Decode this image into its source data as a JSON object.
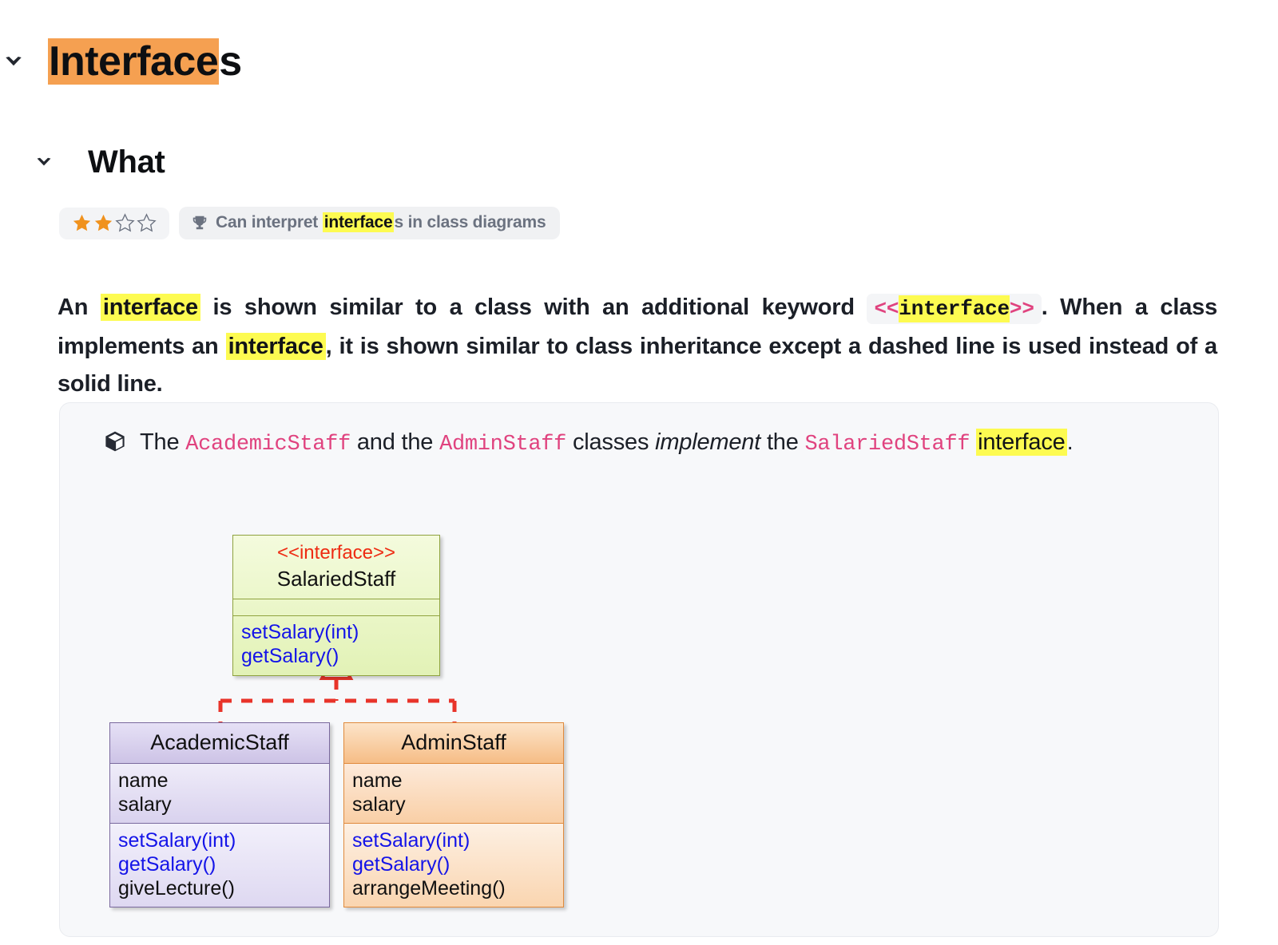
{
  "headings": {
    "h1": {
      "highlighted": "Interface",
      "rest": "s"
    },
    "h2": "What"
  },
  "badge": {
    "stars_filled": 2,
    "stars_total": 4,
    "trophy_icon": "trophy-icon",
    "outcome_pre": "Can interpret ",
    "outcome_mark": "interface",
    "outcome_post": "s in class diagrams"
  },
  "paragraph": {
    "p1": "An ",
    "m1": "interface",
    "p2": " is shown similar to a class with an additional keyword ",
    "code_open": "<<",
    "code_mark": "interface",
    "code_close": ">>",
    "p3": ". When a class implements an ",
    "m2": "interface",
    "p4": ", it is shown similar to class inheritance except a dashed line is used instead of a solid line."
  },
  "callout": {
    "icon": "cube-icon",
    "t1": "The ",
    "c1": "AcademicStaff",
    "t2": " and the ",
    "c2": "AdminStaff",
    "t3": " classes ",
    "em": "implement",
    "t4": " the ",
    "c3": "SalariedStaff",
    "t5": " ",
    "m1": "interface",
    "t6": "."
  },
  "diagram": {
    "interface_box": {
      "stereotype": "<<interface>>",
      "name": "SalariedStaff",
      "attributes": [],
      "methods": [
        "setSalary(int)",
        "getSalary()"
      ]
    },
    "academic_box": {
      "name": "AcademicStaff",
      "attributes": [
        "name",
        "salary"
      ],
      "methods": [
        {
          "text": "setSalary(int)",
          "color": "#1414e8"
        },
        {
          "text": "getSalary()",
          "color": "#1414e8"
        },
        {
          "text": "giveLecture()",
          "color": "#101010"
        }
      ]
    },
    "admin_box": {
      "name": "AdminStaff",
      "attributes": [
        "name",
        "salary"
      ],
      "methods": [
        {
          "text": "setSalary(int)",
          "color": "#1414e8"
        },
        {
          "text": "getSalary()",
          "color": "#1414e8"
        },
        {
          "text": "arrangeMeeting()",
          "color": "#101010"
        }
      ]
    },
    "relation": {
      "type": "realization",
      "style": "dashed",
      "color": "#e8342a",
      "arrow": "hollow-triangle"
    }
  },
  "colors": {
    "highlight_orange": "#f5a051",
    "highlight_yellow": "#fdfb51",
    "code_pink": "#e0437f",
    "star_orange": "#f0921e",
    "uml_red": "#e8342a",
    "uml_blue": "#1414e8",
    "interface_green_border": "#8fa33f",
    "academic_purple_border": "#7a699e",
    "admin_orange_border": "#e08a3c"
  }
}
